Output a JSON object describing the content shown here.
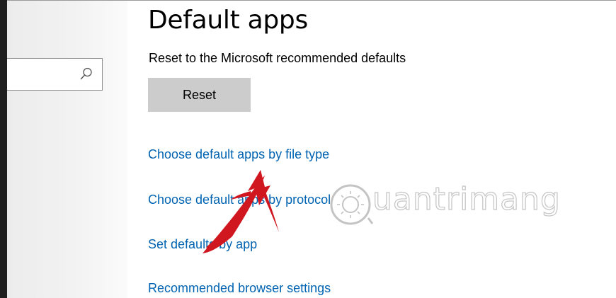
{
  "page": {
    "title": "Default apps"
  },
  "reset": {
    "label": "Reset to the Microsoft recommended defaults",
    "button_label": "Reset"
  },
  "links": {
    "by_file_type": "Choose default apps by file type",
    "by_protocol": "Choose default apps by protocol",
    "by_app": "Set defaults by app",
    "browser": "Recommended browser settings"
  },
  "watermark": {
    "text": "uantrimang"
  },
  "colors": {
    "link": "#0063b1",
    "button_bg": "#cccccc",
    "arrow": "#d0161f",
    "watermark": "#c4c4c4"
  },
  "icons": {
    "search": "search-icon",
    "arrow": "red-arrow-annotation",
    "logo": "watermark-logo-icon"
  }
}
